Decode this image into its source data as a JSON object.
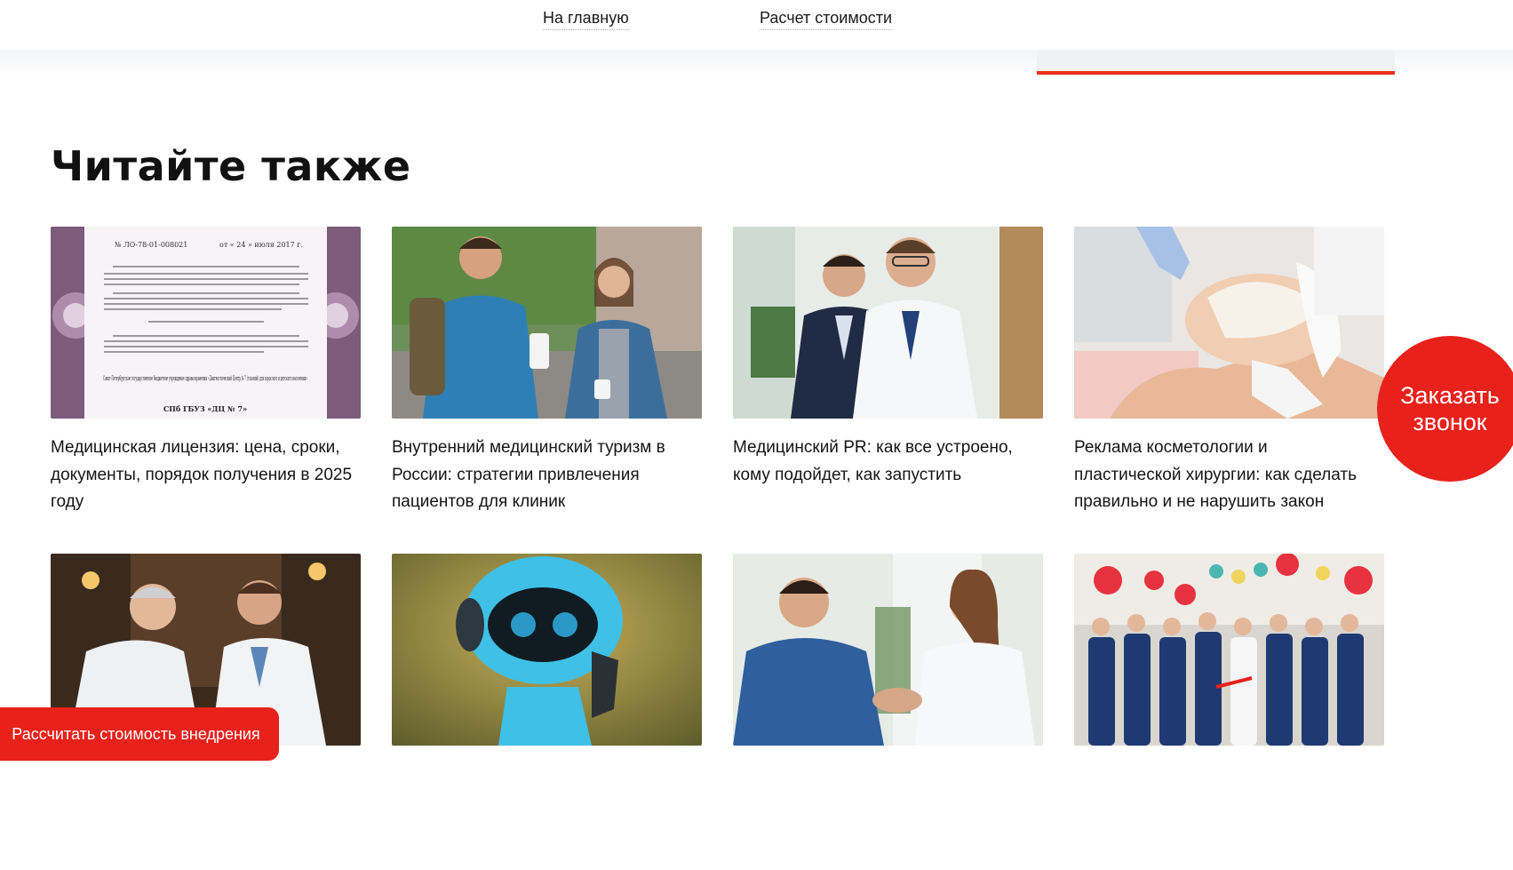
{
  "nav": {
    "home": "На главную",
    "calc": "Расчет стоимости"
  },
  "section": {
    "title": "Читайте также"
  },
  "cards": [
    {
      "title": "Медицинская лицензия: цена, сроки, документы, порядок получения в 2025 году",
      "image": "license-document"
    },
    {
      "title": "Внутренний медицинский туризм в России: стратегии привлечения пациентов для клиник",
      "image": "tourists-backpacks"
    },
    {
      "title": "Медицинский PR: как все устроено, кому подойдет, как запустить",
      "image": "doctor-and-businessman"
    },
    {
      "title": "Реклама косметологии и пластической хирургии: как сделать правильно и не нарушить закон",
      "image": "facial-mask-procedure"
    },
    {
      "title": "",
      "image": "two-doctors-shaking-hands"
    },
    {
      "title": "",
      "image": "blue-robot"
    },
    {
      "title": "",
      "image": "doctor-patient-handshake"
    },
    {
      "title": "",
      "image": "clinic-team-balloons"
    }
  ],
  "license_doc": {
    "number": "№ ЛО-78-01-008021",
    "date": "от « 24 » июля 2017 г.",
    "org": "Санкт-Петербургское государственное бюджетное учреждение здравоохранения «Диагностический Центр № 7 (глазной) для взрослого и детского населения»",
    "short": "СПб ГБУЗ «ДЦ № 7»"
  },
  "floating": {
    "call_line1": "Заказать",
    "call_line2": "звонок",
    "calc_cta": "Рассчитать стоимость внедрения"
  },
  "colors": {
    "accent": "#e8211b",
    "tab_underline": "#e8321f"
  }
}
